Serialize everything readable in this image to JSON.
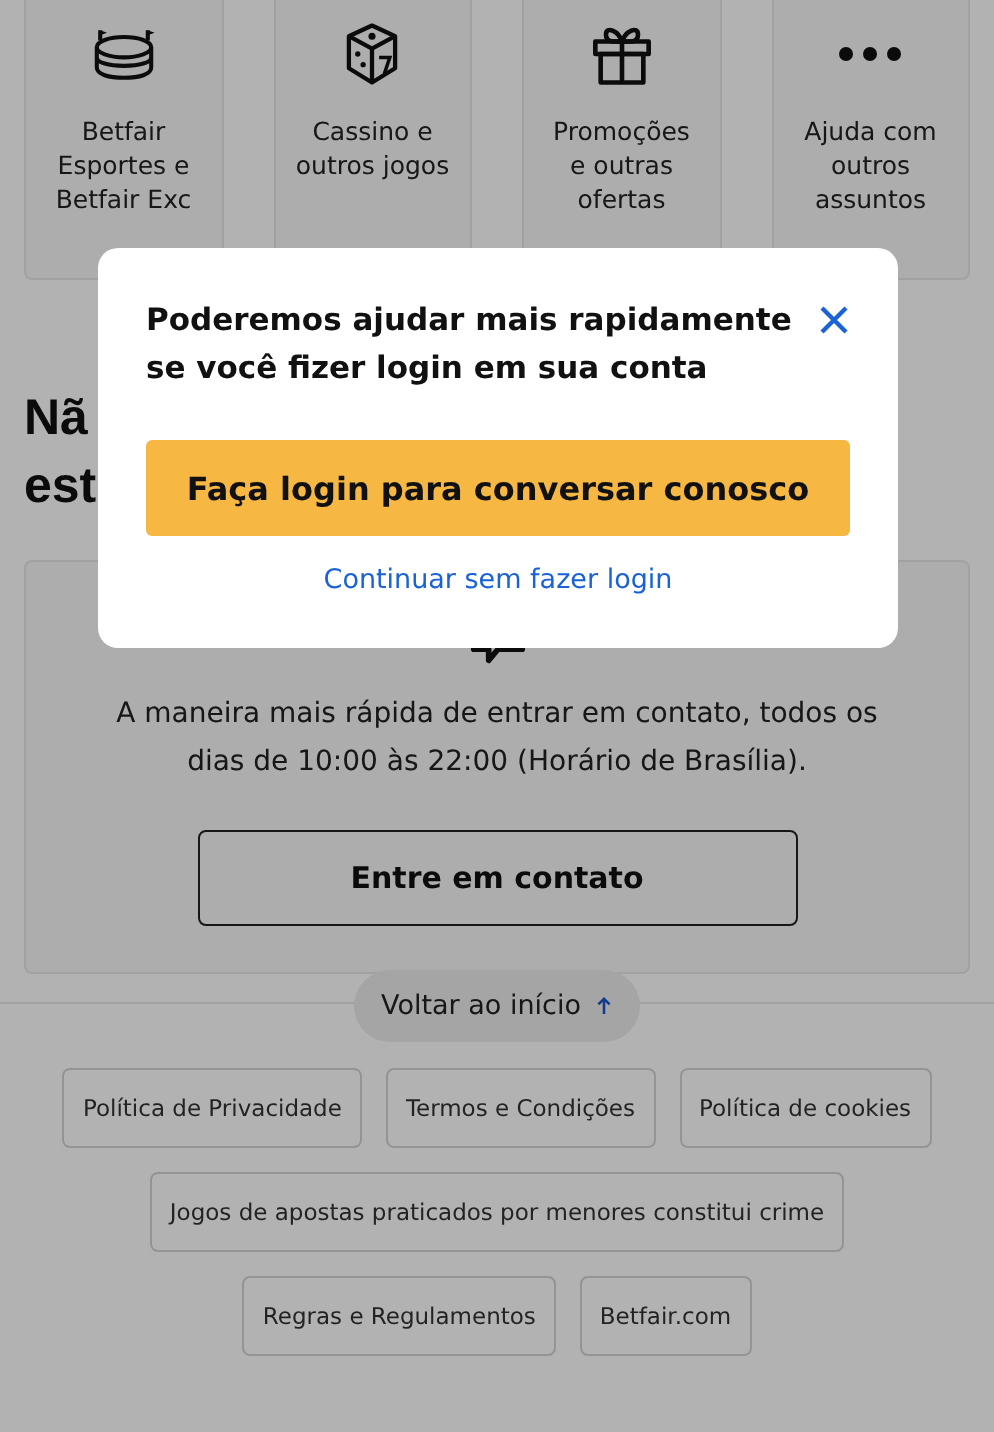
{
  "categories": [
    {
      "label": "Betfair Esportes e Betfair Exc"
    },
    {
      "label": "Cassino e outros jogos"
    },
    {
      "label": "Promoções e outras ofertas"
    },
    {
      "label": "Ajuda com outros assuntos"
    }
  ],
  "heading_lines": [
    "Nã",
    "est"
  ],
  "contact": {
    "description": "A maneira mais rápida de entrar em contato, todos os dias de 10:00 às 22:00 (Horário de Brasília).",
    "button": "Entre em contato"
  },
  "back_to_top": "Voltar ao início",
  "footer_links": [
    [
      "Política de Privacidade",
      "Termos e Condições",
      "Política de cookies"
    ],
    [
      "Jogos de apostas praticados por menores constitui crime"
    ],
    [
      "Regras e Regulamentos",
      "Betfair.com"
    ]
  ],
  "modal": {
    "title": "Poderemos ajudar mais rapidamente se você fizer login em sua conta",
    "primary_button": "Faça login para conversar conosco",
    "secondary_link": "Continuar sem fazer login"
  }
}
